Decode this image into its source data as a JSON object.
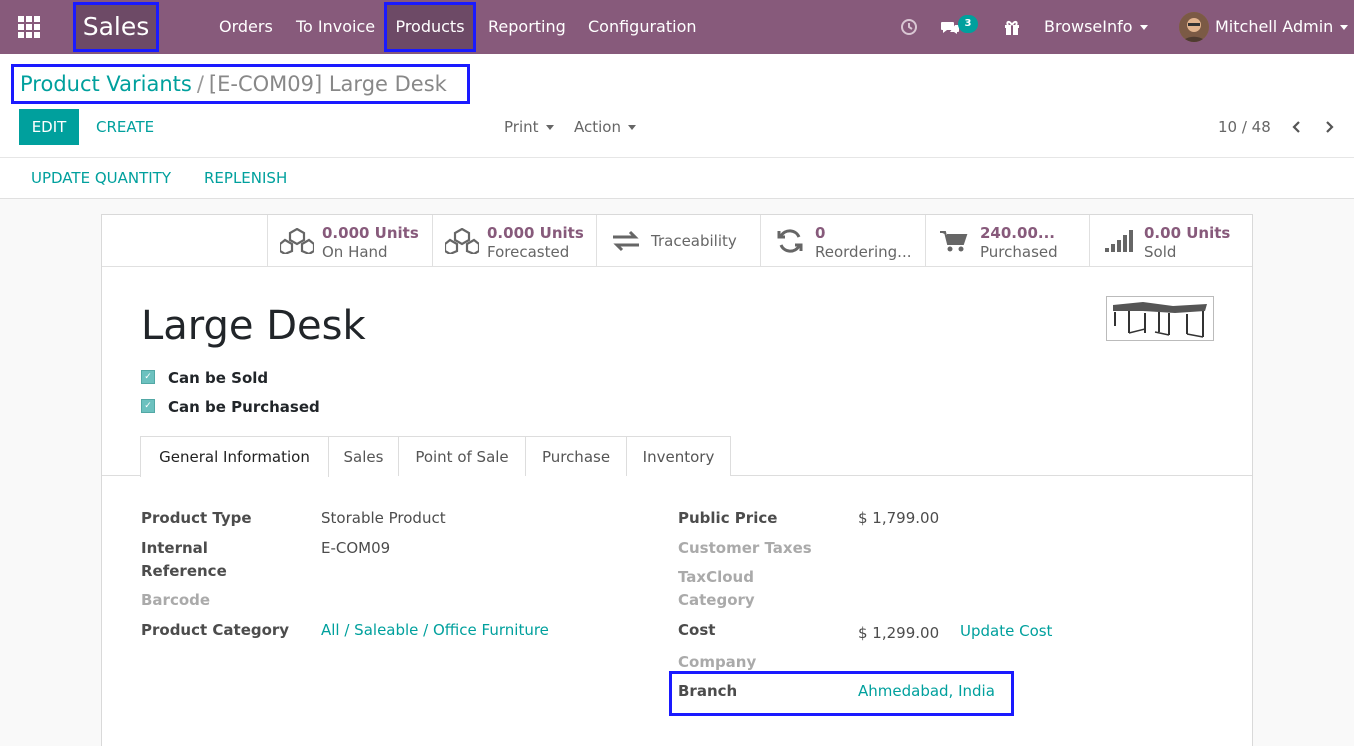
{
  "nav": {
    "brand": "Sales",
    "menu": [
      "Orders",
      "To Invoice",
      "Products",
      "Reporting",
      "Configuration"
    ],
    "company": "BrowseInfo",
    "user": "Mitchell Admin",
    "messages_count": "3"
  },
  "control_panel": {
    "breadcrumb_parent": "Product Variants",
    "breadcrumb_separator": "/",
    "breadcrumb_current": "[E-COM09] Large Desk",
    "edit_label": "EDIT",
    "create_label": "CREATE",
    "print_label": "Print",
    "action_label": "Action",
    "pager": "10 / 48",
    "update_quantity_label": "UPDATE QUANTITY",
    "replenish_label": "REPLENISH"
  },
  "stats": {
    "on_hand_value": "0.000 Units",
    "on_hand_label": "On Hand",
    "forecasted_value": "0.000 Units",
    "forecasted_label": "Forecasted",
    "traceability_label": "Traceability",
    "reordering_value": "0",
    "reordering_label": "Reordering...",
    "purchased_value": "240.00...",
    "purchased_label": "Purchased",
    "sold_value": "0.00 Units",
    "sold_label": "Sold"
  },
  "product": {
    "name": "Large Desk",
    "can_be_sold_label": "Can be Sold",
    "can_be_purchased_label": "Can be Purchased"
  },
  "tabs": [
    "General Information",
    "Sales",
    "Point of Sale",
    "Purchase",
    "Inventory"
  ],
  "general_info": {
    "product_type_label": "Product Type",
    "product_type_value": "Storable Product",
    "internal_ref_label_1": "Internal",
    "internal_ref_label_2": "Reference",
    "internal_ref_value": "E-COM09",
    "barcode_label": "Barcode",
    "category_label": "Product Category",
    "category_value": "All / Saleable / Office Furniture",
    "public_price_label": "Public Price",
    "public_price_value": "$ 1,799.00",
    "customer_taxes_label": "Customer Taxes",
    "taxcloud_label_1": "TaxCloud",
    "taxcloud_label_2": "Category",
    "cost_label": "Cost",
    "cost_value": "$ 1,299.00",
    "update_cost_label": "Update Cost",
    "company_label": "Company",
    "branch_label": "Branch",
    "branch_value": "Ahmedabad, India"
  },
  "colors": {
    "navbar": "#875a7b",
    "accent": "#00a09d",
    "highlight_box": "#1a1aff"
  }
}
